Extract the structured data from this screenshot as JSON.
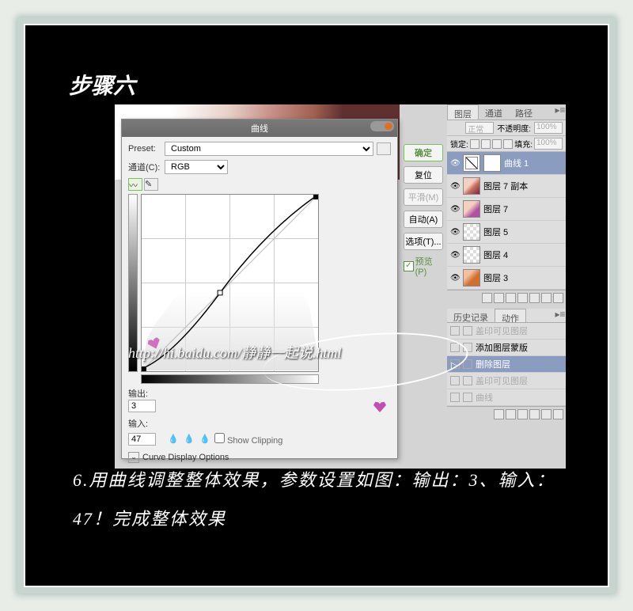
{
  "step_title": "步骤六",
  "dialog": {
    "title": "曲线",
    "preset_label": "Preset:",
    "preset_value": "Custom",
    "channel_label": "通道(C):",
    "channel_value": "RGB",
    "output_label": "输出:",
    "output_value": "3",
    "input_label": "输入:",
    "input_value": "47",
    "show_clipping": "Show Clipping",
    "display_options": "Curve Display Options"
  },
  "buttons": {
    "ok": "确定",
    "reset": "复位",
    "smooth": "平滑(M)",
    "auto": "自动(A)",
    "options": "选项(T)...",
    "preview": "预览(P)"
  },
  "panels": {
    "tab_layers": "图层",
    "tab_channels": "通道",
    "tab_paths": "路径",
    "blend": "正常",
    "opacity_label": "不透明度:",
    "opacity_value": "100%",
    "lock_label": "锁定:",
    "fill_label": "填充:",
    "fill_value": "100%",
    "layers": [
      "曲线 1",
      "图层 7 副本",
      "图层 7",
      "图层 5",
      "图层 4",
      "图层 3"
    ],
    "tab_history": "历史记录",
    "tab_actions": "动作",
    "actions": [
      "盖印可见图层",
      "添加图层蒙版",
      "删除图层",
      "盖印可见图层",
      "曲线"
    ]
  },
  "watermark": "http://hi.baidu.com/静静一起说.html",
  "caption": "6.用曲线调整整体效果，参数设置如图：输出：3、输入：47！完成整体效果"
}
